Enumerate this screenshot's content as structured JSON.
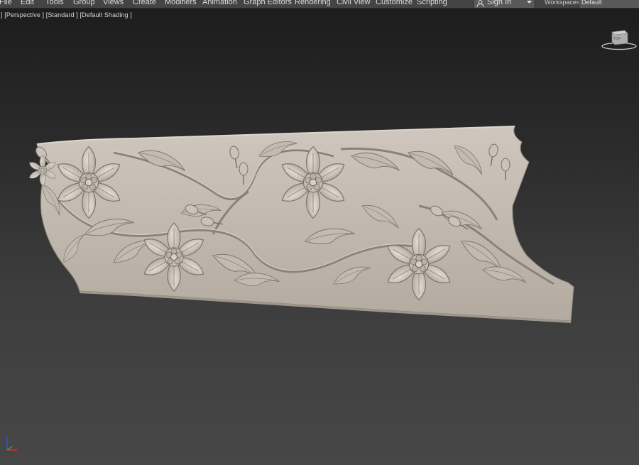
{
  "menubar": {
    "items": [
      "File",
      "Edit",
      "Tools",
      "Group",
      "Views",
      "Create",
      "Modifiers",
      "Animation",
      "Graph Editors",
      "Rendering",
      "Civil View",
      "Customize",
      "Scripting"
    ],
    "signin_label": "Sign In",
    "workspaces_label": "Workspaces:",
    "workspaces_value": "Default"
  },
  "viewport": {
    "label_prefix": "]",
    "view_label": "[Perspective ]",
    "mode_label": "[Standard ]",
    "shading_label": "[Default Shading ]",
    "viewcube_face": "TOP"
  },
  "colors": {
    "menubar_bg": "#444444",
    "viewport_top": "#1d1d1d",
    "viewport_bottom": "#474747",
    "model_color": "#bdb4aa",
    "axis_x": "#e03030",
    "axis_y": "#30c030",
    "axis_z": "#3050ff"
  }
}
